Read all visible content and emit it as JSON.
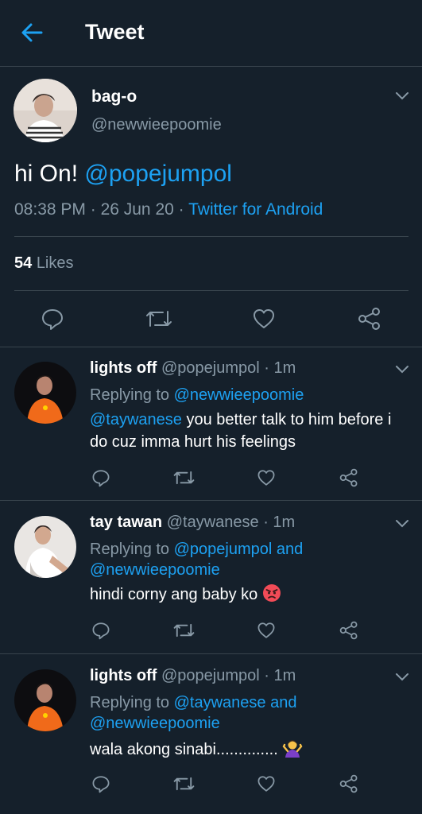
{
  "header": {
    "title": "Tweet"
  },
  "tweet": {
    "display_name": "bag-o",
    "handle": "@newwieepoomie",
    "text": "hi On!",
    "mention": "@popejumpol",
    "time": "08:38 PM",
    "date": "26 Jun 20",
    "source": "Twitter for Android",
    "likes_count": "54",
    "likes_label": "Likes"
  },
  "replies": [
    {
      "display_name": "lights off",
      "handle": "@popejumpol",
      "time": "· 1m",
      "replying_label": "Replying to",
      "replying_to": "@newwieepoomie",
      "mention": "@taywanese",
      "text": " you better talk to him before i do cuz imma hurt his feelings"
    },
    {
      "display_name": "tay tawan",
      "handle": "@taywanese",
      "time": "· 1m",
      "replying_label": "Replying to",
      "replying_to": "@popejumpol and @newwieepoomie",
      "text": "hindi corny ang baby ko",
      "emoji": "angry-face"
    },
    {
      "display_name": "lights off",
      "handle": "@popejumpol",
      "time": "· 1m",
      "replying_label": "Replying to",
      "replying_to": "@taywanese and @newwieepoomie",
      "text": "wala akong sinabi..............",
      "emoji": "person-shrugging"
    }
  ],
  "icons": {
    "back": "arrow-left-icon",
    "reply": "reply-icon",
    "retweet": "retweet-icon",
    "like": "heart-icon",
    "share": "share-icon",
    "more": "chevron-down-icon"
  },
  "colors": {
    "background": "#15202b",
    "accent": "#1da1f2",
    "muted": "#8899a6",
    "divider": "#38444d"
  }
}
